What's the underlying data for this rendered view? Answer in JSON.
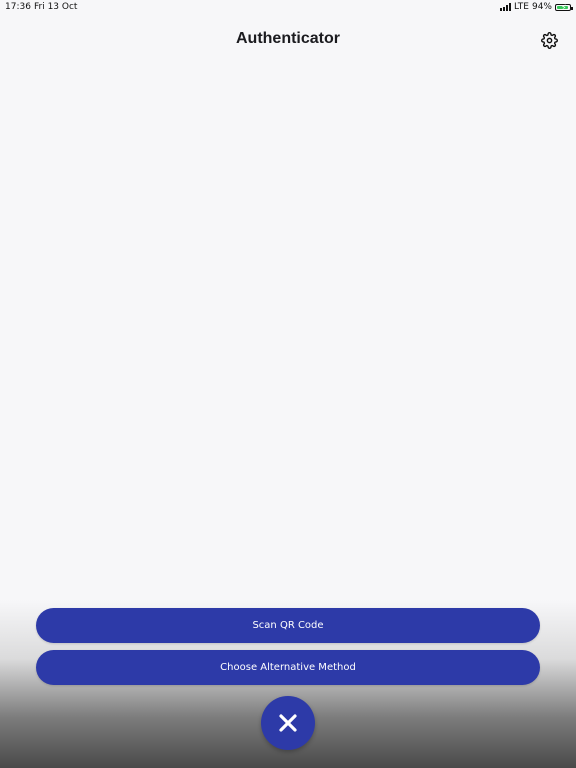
{
  "status_bar": {
    "time": "17:36",
    "date": "Fri 13 Oct",
    "network": "LTE",
    "battery": "94%",
    "battery_level": 0.94,
    "battery_color": "#34c759"
  },
  "header": {
    "title": "Authenticator",
    "settings_icon": "gear-icon"
  },
  "actions": {
    "scan_label": "Scan QR Code",
    "alternative_label": "Choose Alternative Method",
    "close_icon": "close-icon"
  },
  "colors": {
    "accent": "#2d3aa8",
    "background": "#f7f7f9"
  }
}
